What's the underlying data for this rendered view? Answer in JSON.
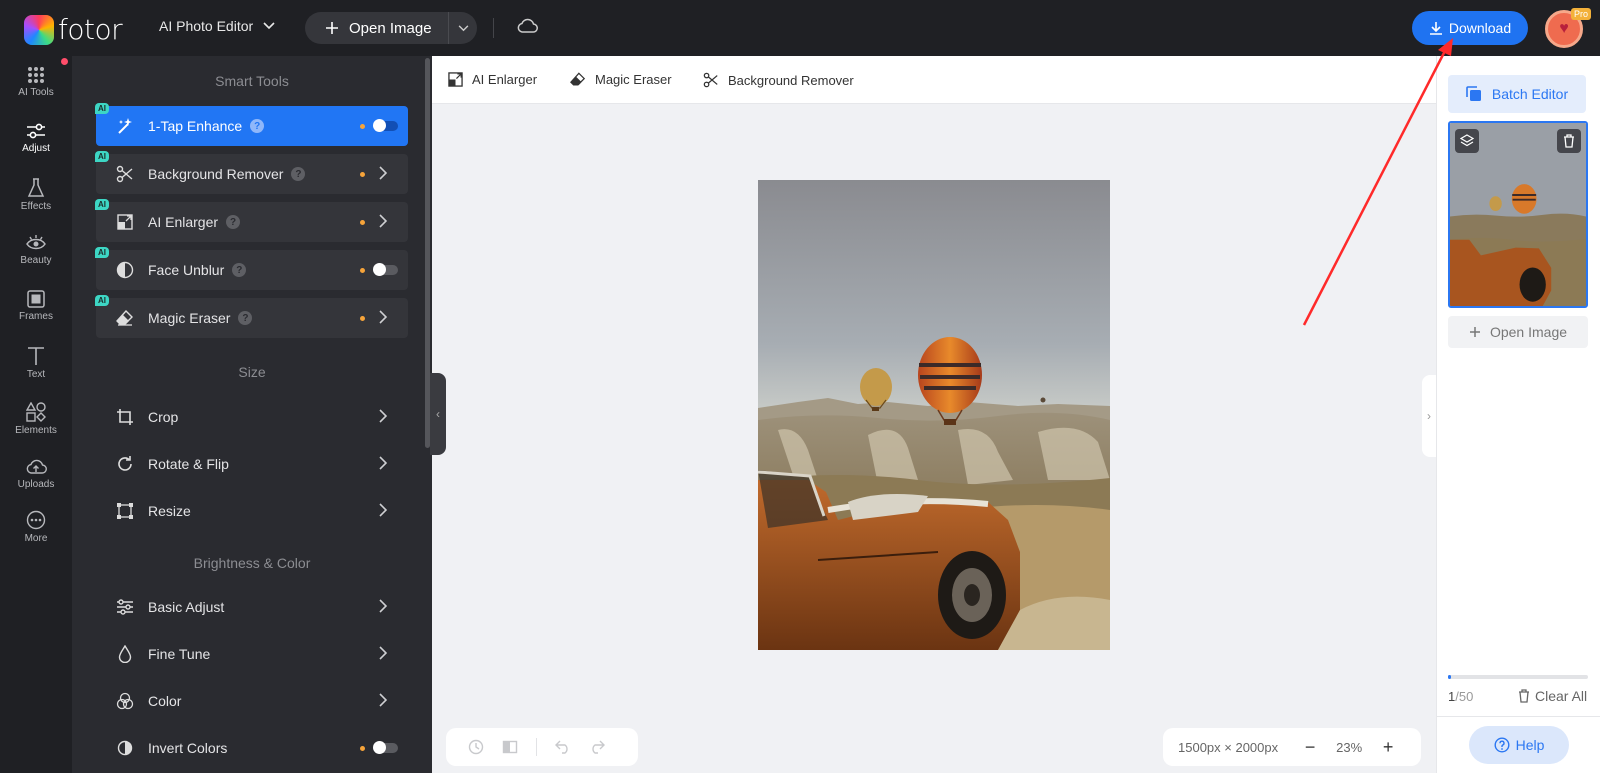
{
  "header": {
    "logo_text": "fotor",
    "editor_mode": "AI Photo Editor",
    "open_image_label": "Open Image",
    "download_label": "Download",
    "pro_badge": "Pro",
    "accent_color": "#1f73f1"
  },
  "rail": {
    "items": [
      {
        "label": "AI Tools",
        "icon": "grid-dots-icon"
      },
      {
        "label": "Adjust",
        "icon": "sliders-icon"
      },
      {
        "label": "Effects",
        "icon": "flask-icon"
      },
      {
        "label": "Beauty",
        "icon": "eye-icon"
      },
      {
        "label": "Frames",
        "icon": "frame-icon"
      },
      {
        "label": "Text",
        "icon": "text-t-icon"
      },
      {
        "label": "Elements",
        "icon": "shapes-icon"
      },
      {
        "label": "Uploads",
        "icon": "cloud-upload-icon"
      },
      {
        "label": "More",
        "icon": "more-dots-icon"
      }
    ]
  },
  "panel": {
    "smart_tools_title": "Smart Tools",
    "size_title": "Size",
    "brightness_title": "Brightness & Color",
    "ai_badge": "AI",
    "smart_tools": [
      {
        "label": "1-Tap Enhance",
        "control": "toggle"
      },
      {
        "label": "Background Remover",
        "control": "chevron"
      },
      {
        "label": "AI Enlarger",
        "control": "chevron"
      },
      {
        "label": "Face Unblur",
        "control": "toggle"
      },
      {
        "label": "Magic Eraser",
        "control": "chevron"
      }
    ],
    "size_tools": [
      {
        "label": "Crop"
      },
      {
        "label": "Rotate & Flip"
      },
      {
        "label": "Resize"
      }
    ],
    "color_tools": [
      {
        "label": "Basic Adjust"
      },
      {
        "label": "Fine Tune"
      },
      {
        "label": "Color"
      },
      {
        "label": "Invert Colors"
      }
    ]
  },
  "quickbar": {
    "items": [
      {
        "label": "AI Enlarger",
        "icon": "enlarge-icon"
      },
      {
        "label": "Magic Eraser",
        "icon": "eraser-icon"
      },
      {
        "label": "Background Remover",
        "icon": "scissors-icon"
      }
    ]
  },
  "canvas": {
    "dimensions": "1500px × 2000px",
    "zoom": "23%"
  },
  "right_panel": {
    "batch_editor_label": "Batch Editor",
    "open_image_label": "Open Image",
    "count_current": "1",
    "count_total": "/50",
    "clear_all_label": "Clear All",
    "help_label": "Help",
    "progress_fraction": 0.02
  }
}
